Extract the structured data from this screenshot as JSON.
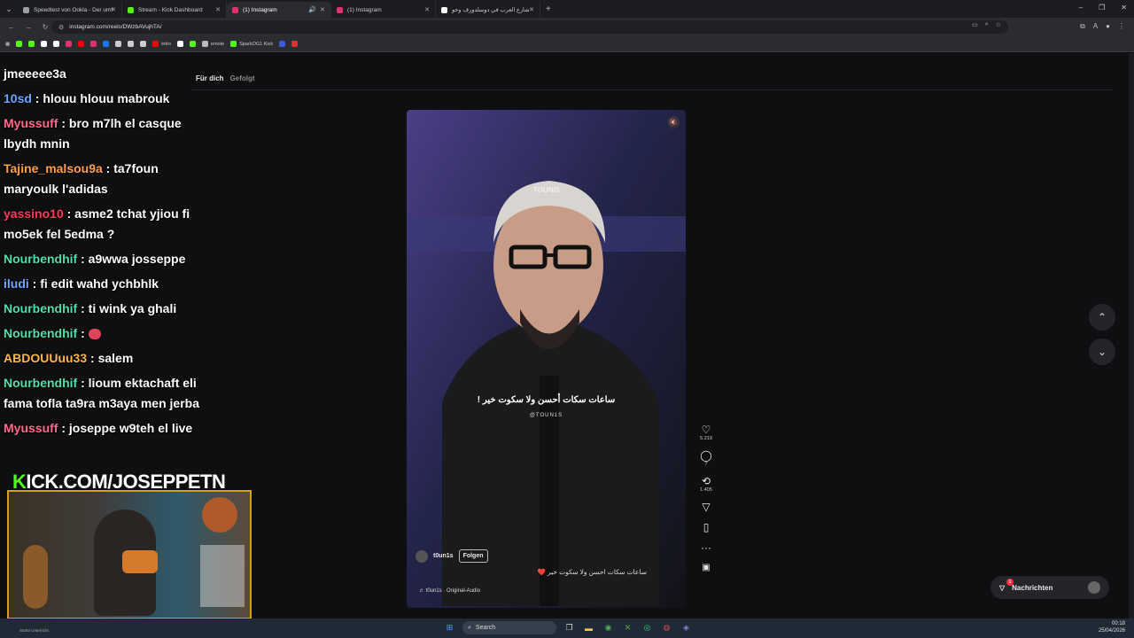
{
  "browser": {
    "tabs": [
      {
        "title": "Speedtest von Ookla - Der umf",
        "color": "#9aa0a6"
      },
      {
        "title": "Stream - Kick Dashboard",
        "color": "#53fc18"
      },
      {
        "title": "(1) Instagram",
        "color": "#e1306c",
        "active": true
      },
      {
        "title": "(1) Instagram",
        "color": "#e1306c"
      },
      {
        "title": "شارع العرب في دوسلدورف وجو",
        "color": "#ffffff"
      }
    ],
    "new_tab": "+",
    "url": "instagram.com/reels/DWzbAVujhTA/",
    "window_controls": [
      "–",
      "❐",
      "✕"
    ]
  },
  "bookmarks": [
    {
      "label": "",
      "color": "#53fc18"
    },
    {
      "label": "",
      "color": "#53fc18"
    },
    {
      "label": "",
      "color": "#ffffff"
    },
    {
      "label": "",
      "color": "#ffffff"
    },
    {
      "label": "",
      "color": "#e1306c"
    },
    {
      "label": "",
      "color": "#ff0000"
    },
    {
      "label": "",
      "color": "#e1306c"
    },
    {
      "label": "",
      "color": "#1877f2"
    },
    {
      "label": "",
      "color": "#cccccc"
    },
    {
      "label": "",
      "color": "#cccccc"
    },
    {
      "label": "",
      "color": "#cccccc"
    },
    {
      "label": "intro",
      "color": "#ff0000"
    },
    {
      "label": "",
      "color": "#ffffff"
    },
    {
      "label": "",
      "color": "#53fc18"
    },
    {
      "label": "emote",
      "color": "#bbbbbb"
    },
    {
      "label": "SparkOG1 Kick",
      "color": "#53fc18"
    },
    {
      "label": "",
      "color": "#3b5bdb"
    },
    {
      "label": "",
      "color": "#e03131"
    }
  ],
  "instagram": {
    "tabs": {
      "for_you": "Für dich",
      "following": "Gefolgt"
    },
    "video": {
      "watermark": "TOUNIS",
      "subtitle": "ساعات سكات أحسن ولا سكوت خير !",
      "subtitle_handle": "@TOUN1S",
      "author": "t0un1s",
      "follow_label": "Folgen",
      "caption": "ساعات سكات احسن ولا سكوت خير ❤️",
      "audio": "♬ t0un1s · Original-Audio"
    },
    "actions": {
      "likes": "5.219",
      "comments": "7",
      "reposts": "1.405",
      "more": "···"
    },
    "messages": {
      "label": "Nachrichten",
      "badge": "1"
    }
  },
  "chat": [
    {
      "user": "",
      "color": "#ffffff",
      "text": "jmeeeee3a"
    },
    {
      "user": "10sd",
      "color": "#6fa8ff",
      "text": " : hlouu hlouu mabrouk"
    },
    {
      "user": "Myussuff",
      "color": "#ff6b8a",
      "text": " : bro m7lh el casque lbydh mnin"
    },
    {
      "user": "Tajine_malsou9a",
      "color": "#ffa14a",
      "text": " : ta7foun maryoulk l'adidas"
    },
    {
      "user": "yassino10",
      "color": "#ff3b5c",
      "text": " : asme2 tchat yjiou fi mo5ek fel 5edma ?"
    },
    {
      "user": "Nourbendhif",
      "color": "#4fe0b0",
      "text": " : a9wwa josseppe"
    },
    {
      "user": "iludi",
      "color": "#6fa8ff",
      "text": " : fi edit wahd ychbhlk"
    },
    {
      "user": "Nourbendhif",
      "color": "#4fe0b0",
      "text": " : ti wink ya ghali"
    },
    {
      "user": "Nourbendhif",
      "color": "#4fe0b0",
      "text": " : ",
      "emote": true
    },
    {
      "user": "ABDOUUuu33",
      "color": "#ffb84a",
      "text": " : salem"
    },
    {
      "user": "Nourbendhif",
      "color": "#4fe0b0",
      "text": " : lioum ektachaft eli fama tofla ta9ra m3aya men jerba"
    },
    {
      "user": "Myussuff",
      "color": "#ff6b8a",
      "text": " : joseppe w9teh el live"
    }
  ],
  "stream_overlay": {
    "kick_k": "K",
    "kick_text": "ICK.COM/JOSEPPETN"
  },
  "taskbar": {
    "search": "Search",
    "left_text": "Starte Unterricht",
    "time": "00:18",
    "date": "25/04/2026"
  }
}
